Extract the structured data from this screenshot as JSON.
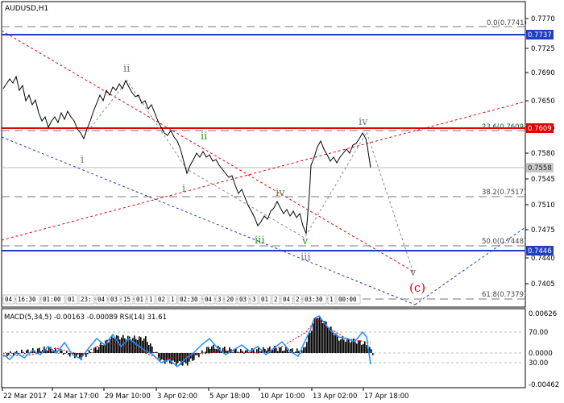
{
  "chart_title": "AUDUSD,H1",
  "price_axis": {
    "ticks": [
      "0.7770",
      "0.7725",
      "0.7690",
      "0.7650",
      "0.7615",
      "0.7580",
      "0.7545",
      "0.7510",
      "0.7475",
      "0.7440",
      "0.7405"
    ],
    "tagged": [
      {
        "label": "0.7737",
        "color": "#1f3fbf",
        "text_color": "#ffffff"
      },
      {
        "label": "0.7609",
        "color": "#e00000",
        "text_color": "#ffffff"
      },
      {
        "label": "0.7558",
        "color": "#c8c8c8",
        "text_color": "#222222"
      },
      {
        "label": "0.7446",
        "color": "#1f3fbf",
        "text_color": "#ffffff"
      }
    ]
  },
  "fib_levels": [
    {
      "label": "0.0(0.7741)"
    },
    {
      "label": "23.6(0.7609)"
    },
    {
      "label": "38.2(0.7517)"
    },
    {
      "label": "50.0(0.7448)"
    },
    {
      "label": "61.8(0.7379)"
    }
  ],
  "wave_labels": {
    "i_gray": "i",
    "ii_gray": "ii",
    "iii_gray": "iii",
    "iv_gray": "iv",
    "v_gray": "v",
    "i_green": "i",
    "ii_green": "ii",
    "iii_green": "iii",
    "iv_green": "iv",
    "v_green": "v",
    "c_red": "(c)"
  },
  "strip_cells": [
    "04",
    "16:30",
    "01:00",
    "01",
    "23:",
    "04",
    "03",
    "15",
    "01",
    "1",
    "02",
    "1",
    "02:30",
    "04",
    "3",
    "20",
    "03",
    "3",
    "01",
    "2",
    "04",
    "2",
    "03:30",
    "1",
    "00:00"
  ],
  "macd": {
    "label": "MACD(5,34,5) -0.00163 -0.00089 RSI(14) 31.61",
    "right_ticks": [
      "0.00626",
      "70.00",
      "0.0000",
      "30.00",
      "-0.00462"
    ]
  },
  "time_axis": [
    "22 Mar 2017",
    "24 Mar 17:00",
    "29 Mar 10:00",
    "3 Apr 02:00",
    "5 Apr 18:00",
    "10 Apr 10:00",
    "13 Apr 02:00",
    "17 Apr 18:00"
  ],
  "colors": {
    "blue": "#1f3fbf",
    "red": "#e00000",
    "green": "#3e8e2f",
    "rsi": "#1e90ff"
  }
}
